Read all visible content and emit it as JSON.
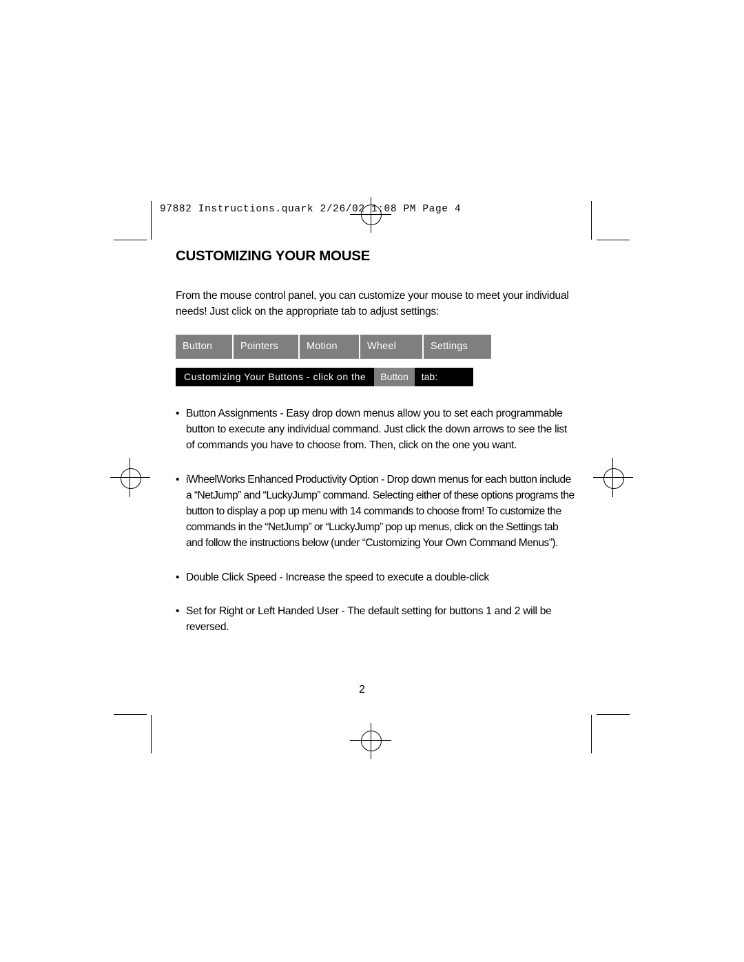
{
  "slug": {
    "text": "97882 Instructions.quark  2/26/02  1:08 PM  Page 4"
  },
  "document": {
    "title": "CUSTOMIZING YOUR MOUSE",
    "intro": "From the mouse control panel, you can customize your mouse to meet your individual needs!  Just click on the appropriate tab to adjust settings:",
    "page_number": "2"
  },
  "tabs": [
    {
      "label": "Button"
    },
    {
      "label": "Pointers"
    },
    {
      "label": "Motion"
    },
    {
      "label": "Wheel"
    },
    {
      "label": "Settings"
    }
  ],
  "caption": {
    "text": "Customizing Your Buttons - click on the",
    "chip": "Button",
    "tail": "tab:"
  },
  "bullets": [
    {
      "marker": "•",
      "text": "Button Assignments - Easy drop down menus allow you to set each programmable button to execute any individual command.  Just click the down arrows to see the list of commands you have to choose from.  Then, click on the one you want."
    },
    {
      "marker": "•",
      "text": "iWheelWorks Enhanced Productivity Option - Drop down menus for each button include a “NetJump” and “LuckyJump” command.  Selecting either of these options programs the button to display a pop up menu with 14 commands to choose from!  To customize the commands in the “NetJump” or “LuckyJump” pop up menus, click on the Settings tab and follow the instructions below (under “Customizing Your Own Command Menus”)."
    },
    {
      "marker": "•",
      "text": "Double Click Speed - Increase the speed to execute a double-click"
    },
    {
      "marker": "•",
      "text": "Set for Right or Left Handed User - The default setting for buttons 1 and 2 will be reversed."
    }
  ]
}
